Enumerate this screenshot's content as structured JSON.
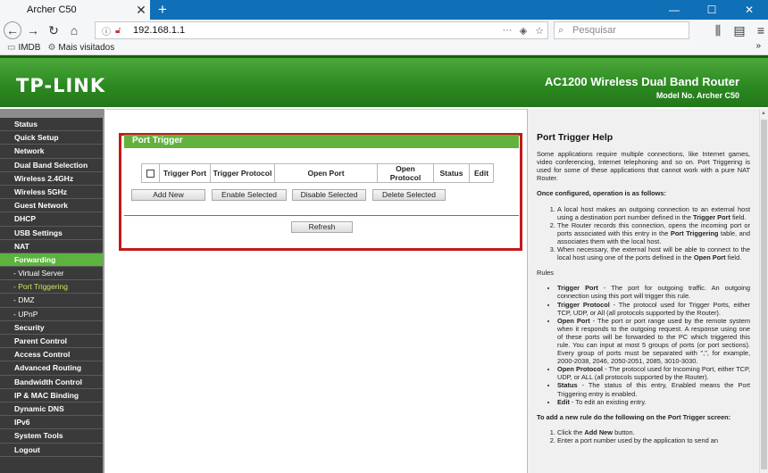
{
  "browser": {
    "tab_title": "Archer C50",
    "tab_close": "✕",
    "new_tab": "+",
    "url": "192.168.1.1",
    "search_placeholder": "Pesquisar",
    "bookmarks": [
      "IMDB",
      "Mais visitados"
    ],
    "bookmarks_more": "»",
    "window_buttons": [
      "—",
      "☐",
      "✕"
    ]
  },
  "header": {
    "logo": "TP-LINK",
    "model_title": "AC1200 Wireless Dual Band Router",
    "model_number": "Model No. Archer C50"
  },
  "sidebar": {
    "items": [
      {
        "label": "Status",
        "type": "main"
      },
      {
        "label": "Quick Setup",
        "type": "main"
      },
      {
        "label": "Network",
        "type": "main"
      },
      {
        "label": "Dual Band Selection",
        "type": "main"
      },
      {
        "label": "Wireless 2.4GHz",
        "type": "main"
      },
      {
        "label": "Wireless 5GHz",
        "type": "main"
      },
      {
        "label": "Guest Network",
        "type": "main"
      },
      {
        "label": "DHCP",
        "type": "main"
      },
      {
        "label": "USB Settings",
        "type": "main"
      },
      {
        "label": "NAT",
        "type": "main"
      },
      {
        "label": "Forwarding",
        "type": "main-active"
      },
      {
        "label": "- Virtual Server",
        "type": "sub"
      },
      {
        "label": "- Port Triggering",
        "type": "sub-active"
      },
      {
        "label": "- DMZ",
        "type": "sub"
      },
      {
        "label": "- UPnP",
        "type": "sub"
      },
      {
        "label": "Security",
        "type": "main"
      },
      {
        "label": "Parent Control",
        "type": "main"
      },
      {
        "label": "Access Control",
        "type": "main"
      },
      {
        "label": "Advanced Routing",
        "type": "main"
      },
      {
        "label": "Bandwidth Control",
        "type": "main"
      },
      {
        "label": "IP & MAC Binding",
        "type": "main"
      },
      {
        "label": "Dynamic DNS",
        "type": "main"
      },
      {
        "label": "IPv6",
        "type": "main"
      },
      {
        "label": "System Tools",
        "type": "main"
      },
      {
        "label": "Logout",
        "type": "main"
      }
    ]
  },
  "main": {
    "panel_title": "Port Trigger",
    "columns": [
      "Trigger Port",
      "Trigger Protocol",
      "Open Port",
      "Open Protocol",
      "Status",
      "Edit"
    ],
    "buttons": {
      "add_new": "Add New",
      "enable_selected": "Enable Selected",
      "disable_selected": "Disable Selected",
      "delete_selected": "Delete Selected",
      "refresh": "Refresh"
    }
  },
  "help": {
    "title": "Port Trigger Help",
    "intro": "Some applications require multiple connections, like Internet games, video conferencing, Internet telephoning and so on. Port Triggering is used for some of these applications that cannot work with a pure NAT Router.",
    "configured_heading": "Once configured, operation is as follows:",
    "steps": [
      {
        "pre": "A local host makes an outgoing connection to an external host using a destination port number defined in the ",
        "b1": "Trigger Port",
        "post": " field."
      },
      {
        "pre": "The Router records this connection, opens the incoming port or ports associated with this entry in the ",
        "b1": "Port Triggering",
        "post": " table, and associates them with the local host."
      },
      {
        "pre": "When necessary, the external host will be able to connect to the local host using one of the ports defined in the ",
        "b1": "Open Port",
        "post": " field."
      }
    ],
    "rules_heading": "Rules",
    "rules": [
      {
        "b": "Trigger Port",
        "t": " - The port for outgoing traffic. An outgoing connection using this port will trigger this rule."
      },
      {
        "b": "Trigger Protocol",
        "t": " - The protocol used for Trigger Ports, either TCP, UDP, or All (all protocols supported by the Router)."
      },
      {
        "b": "Open Port",
        "t": " - The port or port range used by the remote system when it responds to the outgoing request. A response using one of these ports will be forwarded to the PC which triggered this rule. You can input at most 5 groups of ports (or port sections). Every group of ports must be separated with \",\", for example, 2000-2038, 2046, 2050-2051, 2085, 3010-3030."
      },
      {
        "b": "Open Protocol",
        "t": " - The protocol used for Incoming Port, either TCP, UDP, or ALL (all protocols supported by the Router)."
      },
      {
        "b": "Status",
        "t": " - The status of this entry, Enabled means the Port Triggering entry is enabled."
      },
      {
        "b": "Edit",
        "t": " - To edit an existing entry."
      }
    ],
    "add_heading": "To add a new rule do the following on the Port Trigger screen:",
    "add_steps": [
      {
        "pre": "Click the ",
        "b": "Add New",
        "post": " button."
      },
      {
        "pre": "Enter a port number used by the application to send an",
        "b": "",
        "post": ""
      }
    ]
  }
}
